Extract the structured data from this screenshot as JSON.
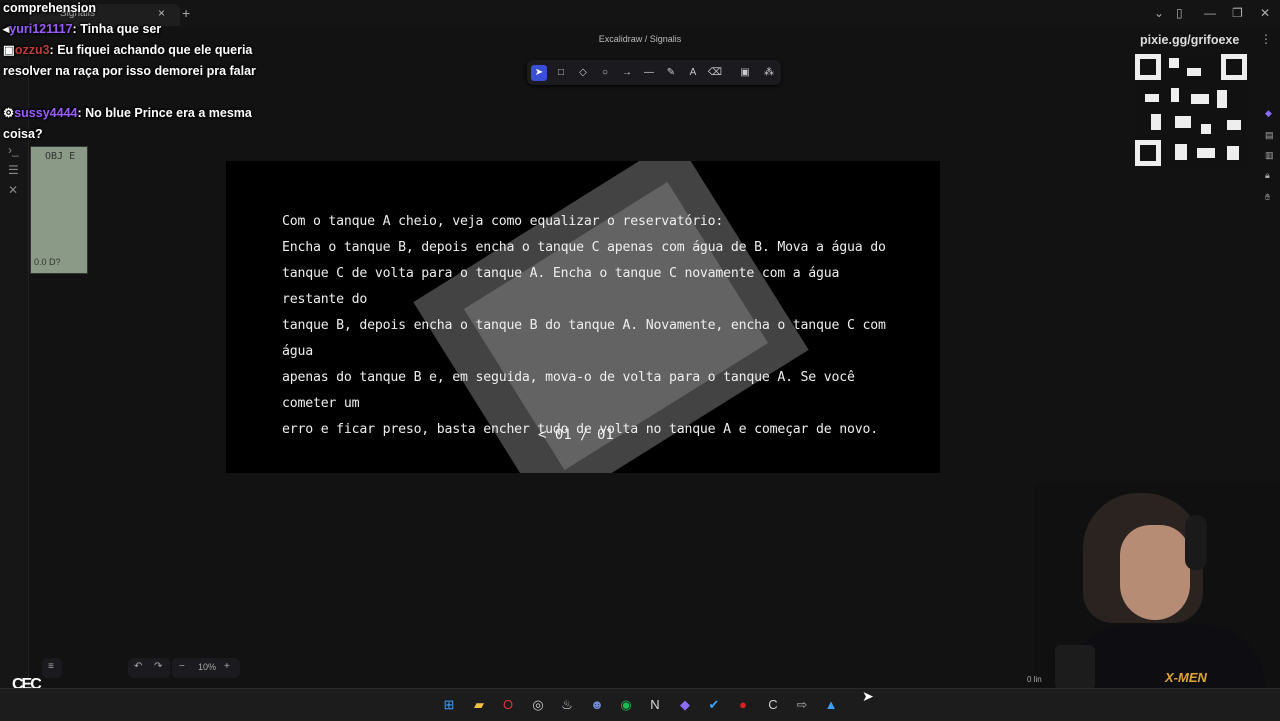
{
  "browser": {
    "tab_title": "Signalis",
    "url": "Excalidraw / Signalis",
    "new_tab": "+",
    "close": "×"
  },
  "toolbar": {
    "tools": [
      "select",
      "rectangle",
      "diamond",
      "ellipse",
      "arrow",
      "line",
      "draw",
      "text",
      "eraser",
      "image",
      "more"
    ],
    "active": "select"
  },
  "scene": {
    "lines": [
      "Com o tanque A cheio, veja como equalizar o reservatório:",
      "Encha o tanque B, depois encha o tanque C apenas com água de B. Mova a água do",
      "tanque C de volta para o tanque A. Encha o tanque C novamente com a água restante do",
      "tanque B, depois encha o tanque B do tanque A. Novamente, encha o tanque C com água",
      "apenas do tanque B e, em seguida, mova-o de volta para o tanque A. Se você cometer um",
      "erro e ficar preso, basta encher tudo de volta no tanque A e começar de novo."
    ],
    "pager": "< 01 / 01"
  },
  "chat": {
    "top_text": "comprehension",
    "messages": [
      {
        "user": "yuri121117",
        "text": "Tinha que ser"
      },
      {
        "user": "ozzu3",
        "text": "Eu fiquei achando que ele queria resolver na raça por isso demorei pra falar"
      },
      {
        "user": "sussy4444",
        "text": "No blue Prince era a mesma coisa?"
      }
    ]
  },
  "thumbnail": {
    "top": "OBJ E",
    "bottom": "0.0 D?"
  },
  "qr": {
    "label": "pixie.gg/grifoexe"
  },
  "controls": {
    "zoom": "10%",
    "minus": "−",
    "plus": "+",
    "undo": "↶",
    "redo": "↷"
  },
  "overlay": {
    "tag": "0 lin",
    "logo": "CEC"
  },
  "colors": {
    "accent": "#3b4fd6",
    "chat_user": "#9a5cff",
    "chat_user_alt": "#c03b3b"
  }
}
